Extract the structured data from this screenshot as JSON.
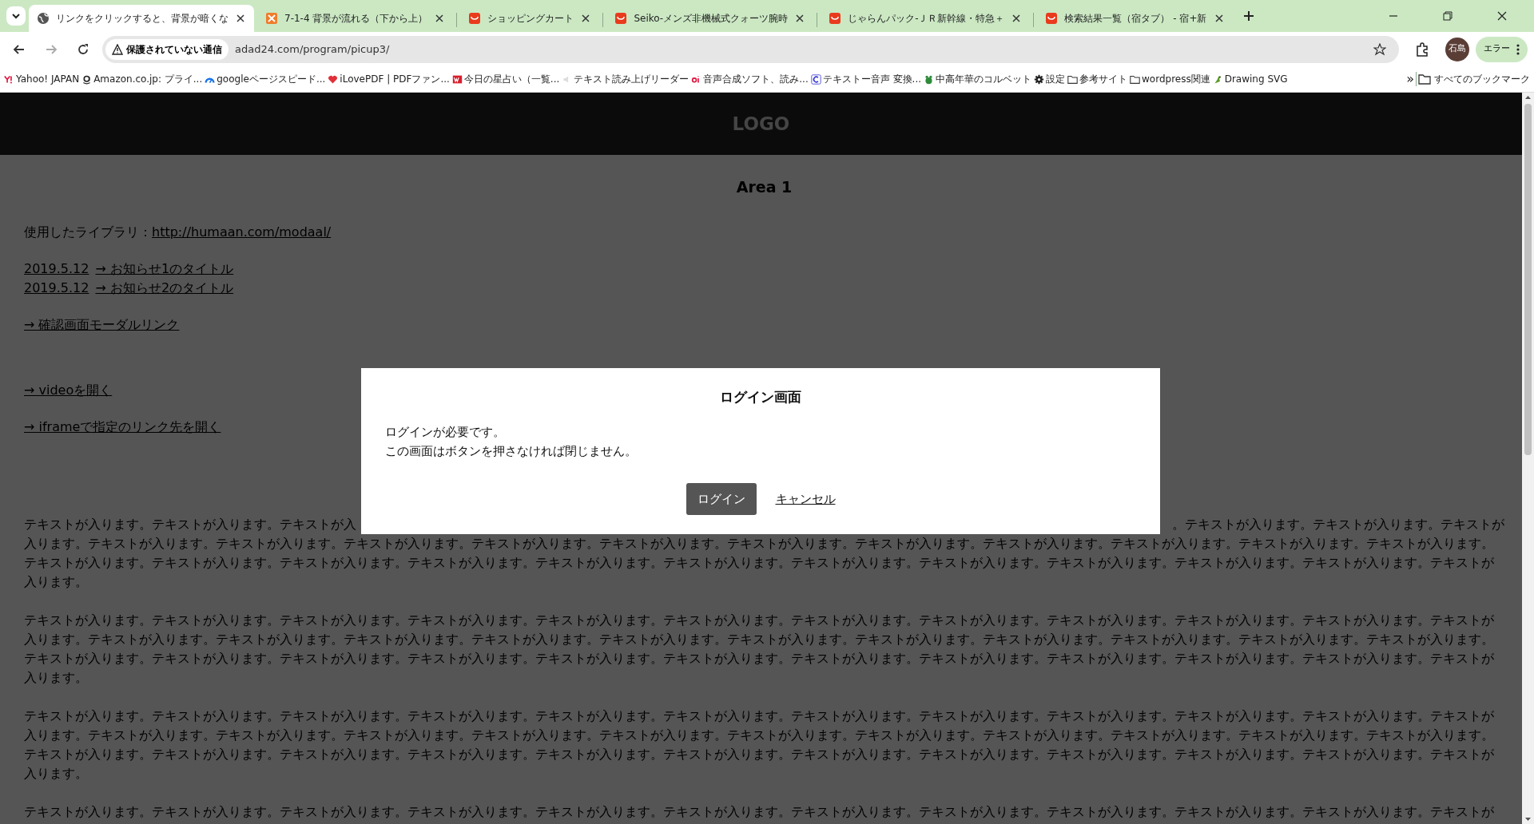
{
  "browser": {
    "tabs": [
      {
        "title": "リンクをクリックすると、背景が暗くな",
        "selected": true
      },
      {
        "title": "7-1-4 背景が流れる（下から上）",
        "selected": false
      },
      {
        "title": "ショッピングカート",
        "selected": false
      },
      {
        "title": "Seiko-メンズ非機械式クォーツ腕時",
        "selected": false
      },
      {
        "title": "じゃらんパック-ＪＲ新幹線・特急＋",
        "selected": false
      },
      {
        "title": "検索結果一覧（宿タブ） - 宿+新",
        "selected": false
      }
    ],
    "address": {
      "security_label": "保護されていない通信",
      "url": "adad24.com/program/picup3/"
    },
    "profile": "石島",
    "error_button": "エラー",
    "bookmarks": [
      {
        "label": "Yahoo! JAPAN"
      },
      {
        "label": "Amazon.co.jp: プライ..."
      },
      {
        "label": "googleページスピード..."
      },
      {
        "label": "iLovePDF | PDFファン..."
      },
      {
        "label": "今日の星占い（一覧..."
      },
      {
        "label": "テキスト読み上げリーダー"
      },
      {
        "label": "音声合成ソフト、読み..."
      },
      {
        "label": "テキストー音声 変換..."
      },
      {
        "label": "中高年華のコルベット"
      },
      {
        "label": "設定"
      },
      {
        "label": "参考サイト"
      },
      {
        "label": "wordpress関連"
      },
      {
        "label": "Drawing SVG"
      }
    ],
    "more_bookmarks": "»",
    "all_bookmarks": "すべてのブックマーク"
  },
  "page": {
    "logo": "LOGO",
    "heading": "Area 1",
    "library": {
      "label": "使用したライブラリ：",
      "link": "http://humaan.com/modaal/"
    },
    "news": [
      {
        "date": "2019.5.12",
        "title": "→ お知らせ1のタイトル"
      },
      {
        "date": "2019.5.12",
        "title": "→ お知らせ2のタイトル"
      }
    ],
    "links": [
      "→ 確認画面モーダルリンク",
      "→ videoを開く",
      "→ iframeで指定のリンク先を開く"
    ],
    "covered_paragraph": {
      "visible_left": "テキストが入ります。テキストが入ります。テキストが入",
      "visible_right": "。テキストが入ります。テキストが入ります。テキストが",
      "rest": "入ります。テキストが入ります。テキストが入ります。テキストが入ります。テキストが入ります。テキストが入ります。テキストが入ります。テキストが入ります。テキストが入ります。テキストが入ります。テキストが入ります。テキストが入ります。テキストが入ります。テキストが入ります。テキストが入ります。テキストが入ります。テキストが入ります。テキストが入ります。テキストが入ります。テキストが入ります。テキストが入ります。テキストが入ります。テキストが入ります。テキストが入ります。"
    },
    "paragraphs": [
      "テキストが入ります。テキストが入ります。テキストが入ります。テキストが入ります。テキストが入ります。テキストが入ります。テキストが入ります。テキストが入ります。テキストが入ります。テキストが入ります。テキストが入ります。テキストが入ります。テキストが入ります。テキストが入ります。テキストが入ります。テキストが入ります。テキストが入ります。テキストが入ります。テキストが入ります。テキストが入ります。テキストが入ります。テキストが入ります。テキストが入ります。テキストが入ります。テキストが入ります。テキストが入ります。テキストが入ります。テキストが入ります。テキストが入ります。テキストが入ります。テキストが入ります。テキストが入ります。テキストが入ります。テキストが入ります。テキストが入ります。",
      "テキストが入ります。テキストが入ります。テキストが入ります。テキストが入ります。テキストが入ります。テキストが入ります。テキストが入ります。テキストが入ります。テキストが入ります。テキストが入ります。テキストが入ります。テキストが入ります。テキストが入ります。テキストが入ります。テキストが入ります。テキストが入ります。テキストが入ります。テキストが入ります。テキストが入ります。テキストが入ります。テキストが入ります。テキストが入ります。テキストが入ります。テキストが入ります。テキストが入ります。テキストが入ります。テキストが入ります。テキストが入ります。テキストが入ります。テキストが入ります。テキストが入ります。テキストが入ります。テキストが入ります。テキストが入ります。テキストが入ります。",
      "テキストが入ります。テキストが入ります。テキストが入ります。テキストが入ります。テキストが入ります。テキストが入ります。テキストが入ります。テキストが入ります。テキストが入ります。テキストが入ります。テキストが入ります。テキストが"
    ]
  },
  "modal": {
    "title": "ログイン画面",
    "lines": [
      "ログインが必要です。",
      "この画面はボタンを押さなければ閉じません。"
    ],
    "login_button": "ログイン",
    "cancel_link": "キャンセル"
  }
}
